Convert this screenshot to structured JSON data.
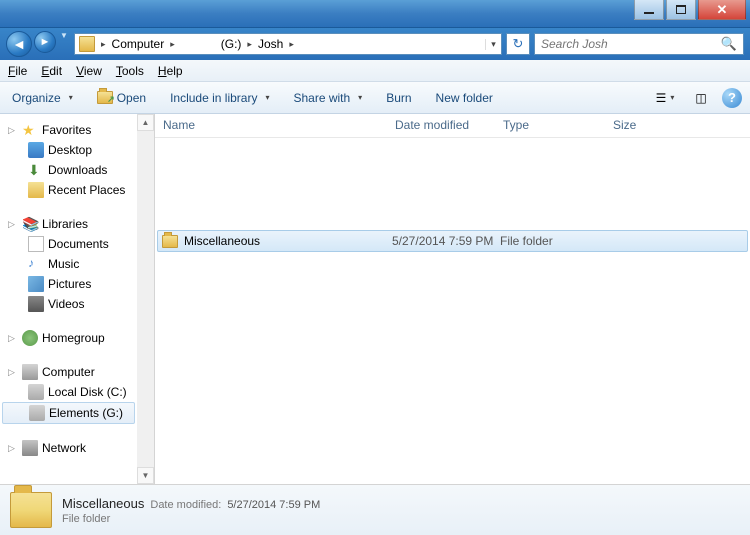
{
  "titlebar": {
    "controls": [
      "minimize",
      "maximize",
      "close"
    ]
  },
  "nav": {
    "breadcrumb": [
      {
        "label": "Computer"
      },
      {
        "label": "(G:)",
        "prefix_hidden": true
      },
      {
        "label": "Josh"
      }
    ],
    "search_placeholder": "Search Josh"
  },
  "menu": [
    "File",
    "Edit",
    "View",
    "Tools",
    "Help"
  ],
  "toolbar": {
    "organize": "Organize",
    "open": "Open",
    "include": "Include in library",
    "share": "Share with",
    "burn": "Burn",
    "newfolder": "New folder"
  },
  "sidebar": {
    "favorites": {
      "label": "Favorites",
      "items": [
        "Desktop",
        "Downloads",
        "Recent Places"
      ]
    },
    "libraries": {
      "label": "Libraries",
      "items": [
        "Documents",
        "Music",
        "Pictures",
        "Videos"
      ]
    },
    "homegroup": {
      "label": "Homegroup"
    },
    "computer": {
      "label": "Computer",
      "items": [
        "Local Disk (C:)",
        "Elements (G:)"
      ],
      "selected_index": 1
    },
    "network": {
      "label": "Network"
    }
  },
  "columns": [
    "Name",
    "Date modified",
    "Type",
    "Size"
  ],
  "files": [
    {
      "name": "Miscellaneous",
      "date": "5/27/2014 7:59 PM",
      "type": "File folder",
      "size": "",
      "selected": true
    }
  ],
  "details": {
    "name": "Miscellaneous",
    "date_label": "Date modified:",
    "date": "5/27/2014 7:59 PM",
    "type": "File folder"
  }
}
